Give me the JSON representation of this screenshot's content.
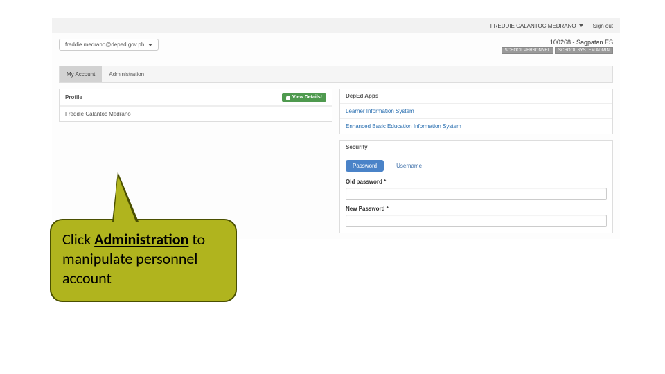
{
  "topbar": {
    "user_name": "FREDDIE CALANTOC MEDRANO",
    "signout": "Sign out"
  },
  "subbar": {
    "email": "freddie.medrano@deped.gov.ph",
    "school": "100268 - Sagpatan ES",
    "badge1": "SCHOOL PERSONNEL",
    "badge2": "SCHOOL SYSTEM ADMIN"
  },
  "tabs": {
    "my_account": "My Account",
    "administration": "Administration"
  },
  "profile": {
    "title": "Profile",
    "view_btn": "View Details!",
    "name": "Freddie Calantoc Medrano"
  },
  "apps": {
    "title": "DepEd Apps",
    "link1": "Learner Information System",
    "link2": "Enhanced Basic Education Information System"
  },
  "security": {
    "title": "Security",
    "tab_password": "Password",
    "tab_username": "Username",
    "old_pw_label": "Old password *",
    "new_pw_label": "New Password *"
  },
  "callout": {
    "pre": "Click ",
    "bold": "Administration",
    "post": " to manipulate personnel account"
  }
}
